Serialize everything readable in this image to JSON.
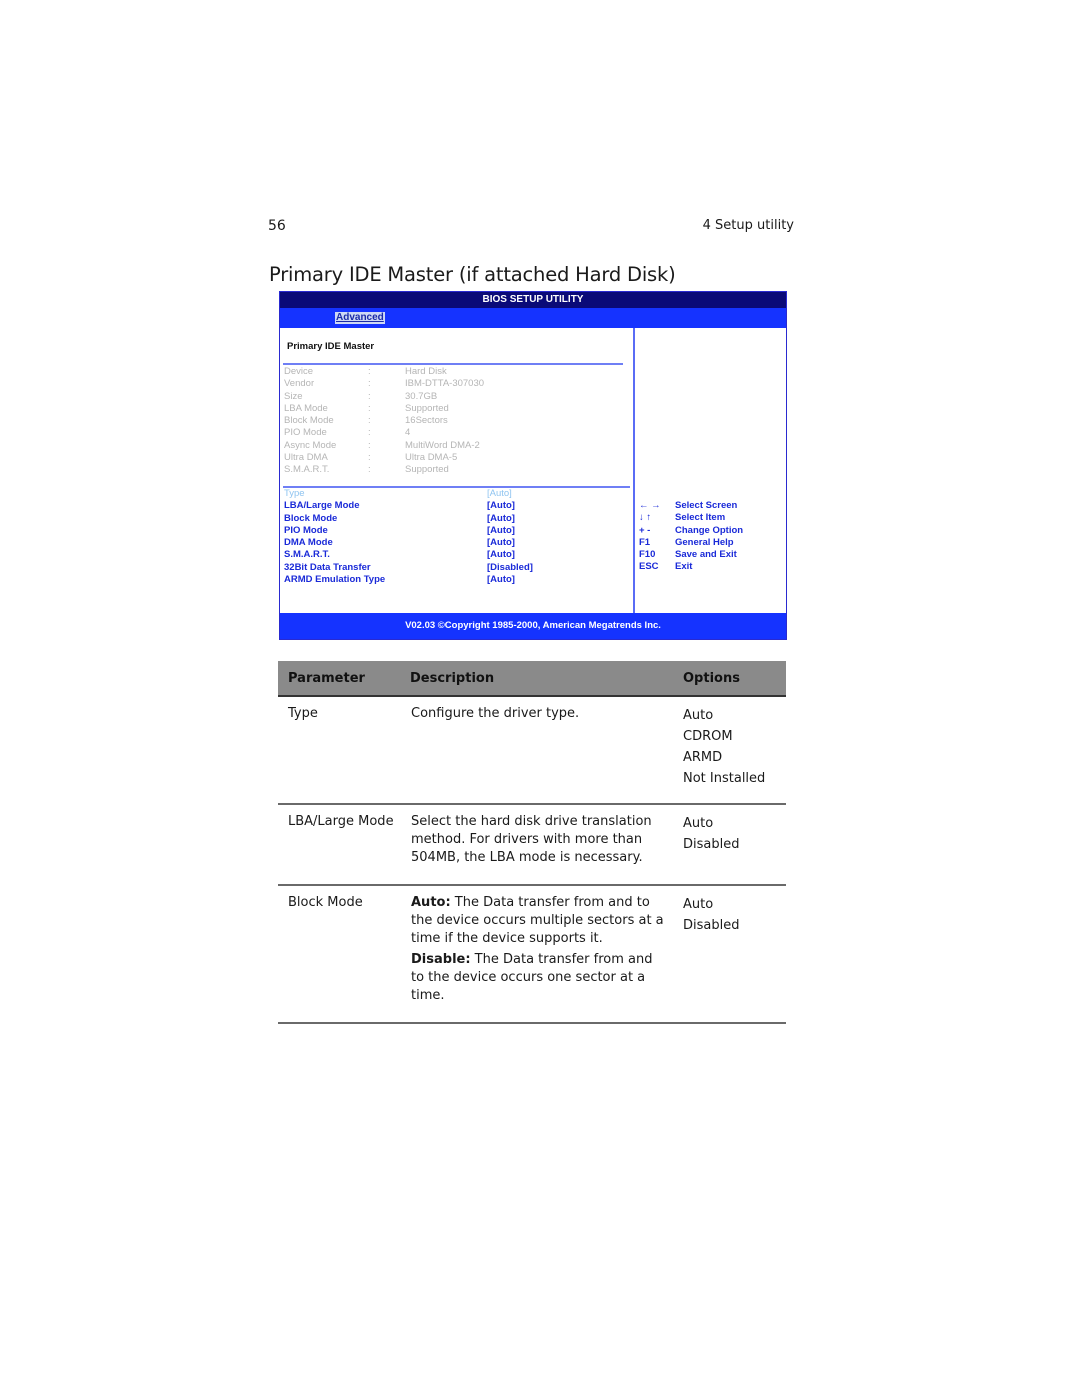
{
  "page": {
    "number": "56",
    "running_header": "4 Setup utility",
    "section_title": "Primary IDE Master (if attached Hard Disk)"
  },
  "bios": {
    "title": "BIOS SETUP UTILITY",
    "menu_tab": "Advanced",
    "panel_title": "Primary IDE Master",
    "colors": {
      "title_bar": "#0a0a78",
      "menu_bar": "#1533ff",
      "item_text": "#1a2ad8",
      "info_text": "#b5b5b5",
      "selected_item": "#8fc4f0"
    },
    "info": [
      {
        "label": "Device",
        "sep": ":",
        "value": "Hard Disk"
      },
      {
        "label": "Vendor",
        "sep": ":",
        "value": "IBM-DTTA-307030"
      },
      {
        "label": "Size",
        "sep": ":",
        "value": "30.7GB"
      },
      {
        "label": "LBA Mode",
        "sep": ":",
        "value": "Supported"
      },
      {
        "label": "Block Mode",
        "sep": ":",
        "value": "16Sectors"
      },
      {
        "label": "PIO Mode",
        "sep": ":",
        "value": "4"
      },
      {
        "label": "Async Mode",
        "sep": ":",
        "value": "MultiWord DMA-2"
      },
      {
        "label": "Ultra DMA",
        "sep": ":",
        "value": "Ultra DMA-5"
      },
      {
        "label": "S.M.A.R.T.",
        "sep": ":",
        "value": "Supported"
      }
    ],
    "options": [
      {
        "label": "Type",
        "value": "[Auto]",
        "selected": true
      },
      {
        "label": "LBA/Large Mode",
        "value": "[Auto]"
      },
      {
        "label": "Block Mode",
        "value": "[Auto]"
      },
      {
        "label": "PIO Mode",
        "value": "[Auto]"
      },
      {
        "label": "DMA Mode",
        "value": "[Auto]"
      },
      {
        "label": "S.M.A.R.T.",
        "value": "[Auto]"
      },
      {
        "label": "32Bit Data Transfer",
        "value": "[Disabled]"
      },
      {
        "label": "ARMD Emulation Type",
        "value": "[Auto]"
      }
    ],
    "keys": [
      {
        "key": "← →",
        "action": "Select Screen"
      },
      {
        "key": "↓ ↑",
        "action": "Select Item"
      },
      {
        "key": "+ -",
        "action": "Change Option"
      },
      {
        "key": "F1",
        "action": "General Help"
      },
      {
        "key": "F10",
        "action": "Save and Exit"
      },
      {
        "key": "ESC",
        "action": "Exit"
      }
    ],
    "footer": "V02.03 ©Copyright 1985-2000, American Megatrends Inc."
  },
  "table": {
    "headers": {
      "parameter": "Parameter",
      "description": "Description",
      "options": "Options"
    },
    "rows": [
      {
        "parameter": "Type",
        "description": [
          {
            "bold": "",
            "text": "Configure the driver type."
          }
        ],
        "options": [
          "Auto",
          "CDROM",
          "ARMD",
          "Not Installed"
        ]
      },
      {
        "parameter": "LBA/Large Mode",
        "description": [
          {
            "bold": "",
            "text": "Select the hard disk drive translation method. For drivers with more than 504MB, the LBA mode is necessary."
          }
        ],
        "options": [
          "Auto",
          "Disabled"
        ]
      },
      {
        "parameter": "Block Mode",
        "description": [
          {
            "bold": "Auto:",
            "text": " The Data transfer from and to the device occurs multiple sectors at a time if the device supports it."
          },
          {
            "bold": "Disable:",
            "text": " The Data transfer from and to the device occurs one sector at a time."
          }
        ],
        "options": [
          "Auto",
          "Disabled"
        ]
      }
    ]
  }
}
